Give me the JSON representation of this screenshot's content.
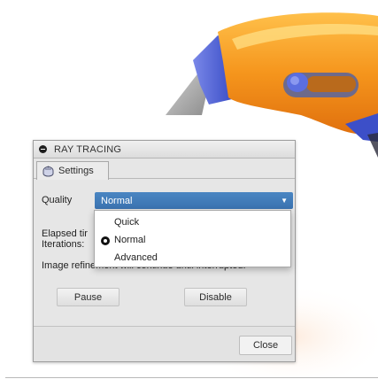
{
  "panel": {
    "title": "RAY TRACING",
    "tab_label": "Settings",
    "quality_label": "Quality",
    "quality_value": "Normal",
    "info_line1": "Elapsed tir",
    "info_line2": "Iterations:",
    "refine_text": "Image refinement will continue until interrupted.",
    "pause_label": "Pause",
    "disable_label": "Disable",
    "close_label": "Close"
  },
  "dropdown": {
    "options": [
      "Quick",
      "Normal",
      "Advanced"
    ],
    "selected": "Normal"
  },
  "icons": {
    "collapse": "collapse-circle-icon",
    "tab": "teapot-icon",
    "dropdown_arrow": "dropdown-arrow-icon"
  },
  "colors": {
    "select_bg": "#3a72b0",
    "knife_orange": "#f39a1e",
    "knife_blue": "#4a5fd6"
  }
}
